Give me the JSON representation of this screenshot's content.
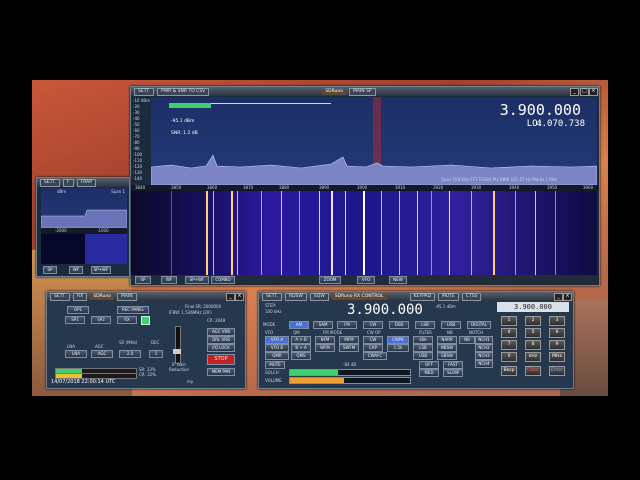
{
  "main_window": {
    "toolbar": {
      "sett": "SETT.",
      "pwr_snr": "PWR & SNR TO CSV",
      "title": "SDRuno",
      "main_sp": "MAIN SP"
    },
    "frequency": "3.900.000",
    "lo_label": "LO:",
    "lo_value": "4.070.738",
    "level": "-95.1 dBm",
    "snr": "SNR: 1.2 dB",
    "db_scale": [
      "-10 dBm",
      "-20",
      "-30",
      "-40",
      "-50",
      "-60",
      "-70",
      "-80",
      "-90",
      "-100",
      "-110",
      "-120",
      "-130",
      "-140",
      "-150"
    ],
    "freq_ticks": [
      "3840",
      "3850",
      "3860",
      "3870",
      "3880",
      "3890",
      "3900",
      "3910",
      "3920",
      "3930",
      "3940",
      "3950",
      "3960"
    ],
    "info_line": "Span 108 KHz  FFT 16384 Pts  RBW 101.07 Hz  Marks 1 KHz",
    "bottom_bar": [
      "SP",
      "WF",
      "SP+WF",
      "COMBO",
      "ZOOM",
      "VFO",
      "NEW"
    ]
  },
  "small_window": {
    "toolbar": [
      "SETT.",
      "F",
      "FRAP",
      "EDIT"
    ],
    "scale": [
      "dBm",
      "-2000",
      "-1000"
    ],
    "span": "Span 1",
    "bottom": [
      "SP",
      "WF",
      "SP+WF"
    ]
  },
  "main_panel": {
    "toolbar": {
      "sett": "SETT.",
      "btn": "RX",
      "title": "SDRuno",
      "main": "MAIN"
    },
    "row1": [
      "OP1",
      "REC PANEL"
    ],
    "row2": [
      "SP1",
      "SP2",
      "RX"
    ],
    "final_sr": "Final SR: 2000000",
    "ifbw": "IFBW: 1.536MHz (2IF)",
    "cr": "CR: 2048",
    "settings": [
      "LNA",
      "AGC",
      "SR (MHz)",
      "DEC"
    ],
    "sr_value": "2.0",
    "dec_value": "1",
    "if_gain": "IF Gain Reduction",
    "side_buttons": [
      "AGC VRB",
      "DRL VRB",
      "I/Q LOCK"
    ],
    "stop": "STOP",
    "mem_pan": "MEM PAN",
    "cpu1": "SR: 33%",
    "cpu2": "CR: 32%",
    "timestamp": "14/07/2018 22:00:14 UTC",
    "mode": "my"
  },
  "rx_control": {
    "toolbar": {
      "sett": "SETT.",
      "rdsw": "RDSW",
      "sqw": "SQW",
      "title": "SDRuno RX CONTROL",
      "keypad": "KEYPAD",
      "mute": "MUTE",
      "ctcss": "CTSS"
    },
    "step_label": "STEP:",
    "step_value": "100 kHz",
    "frequency": "3.900.000",
    "level": "-95.1 dBm",
    "lbl_mode": "MODE",
    "modes": [
      "AM",
      "SAM",
      "FM",
      "CW",
      "DSB",
      "LSB",
      "USB",
      "DIGITAL"
    ],
    "lbl_vfo": "VFO",
    "lbl_qm": "QM",
    "lbl_fm_mode": "FM MODE",
    "lbl_cw_op": "CW OP",
    "lbl_filter": "FILTER",
    "lbl_nb": "NB",
    "lbl_notch": "NOTCH",
    "vfo_buttons": [
      "VFO A",
      "A > B",
      "NFM",
      "MFM",
      "CW",
      "CWPK",
      "40k",
      "NARR",
      "NB",
      "NCH1"
    ],
    "vfo_buttons2": [
      "VFO B",
      "B > A",
      "WFM",
      "SWFM",
      "CAP",
      "1.5k",
      "LSB",
      "NBSW",
      "NCH2"
    ],
    "vfo_buttons3": [
      "QMR",
      "QMS",
      "CWAFC",
      "USB",
      "SBSW",
      "NCH3"
    ],
    "mute_label": "MUTE",
    "squelch_label": "SQLCH",
    "volume_label": "VOLUME",
    "snr_value": "-84 dB",
    "agc_buttons": [
      "OFF",
      "FAST",
      "MED",
      "SLOW",
      "NCH4"
    ],
    "keypad": [
      "1",
      "2",
      "3",
      "4",
      "5",
      "6",
      "7",
      "8",
      "9",
      "0",
      "kHz",
      "MHz"
    ],
    "keypad_actions": [
      "Bksp",
      "Clear",
      "Enter"
    ],
    "keypad_display": "3.900.000"
  },
  "colors": {
    "accent_red": "#c82020",
    "freq_text": "#ffffff",
    "spectrum_bg": "#1d2f66",
    "waterfall_hot": "#ffd27a"
  }
}
